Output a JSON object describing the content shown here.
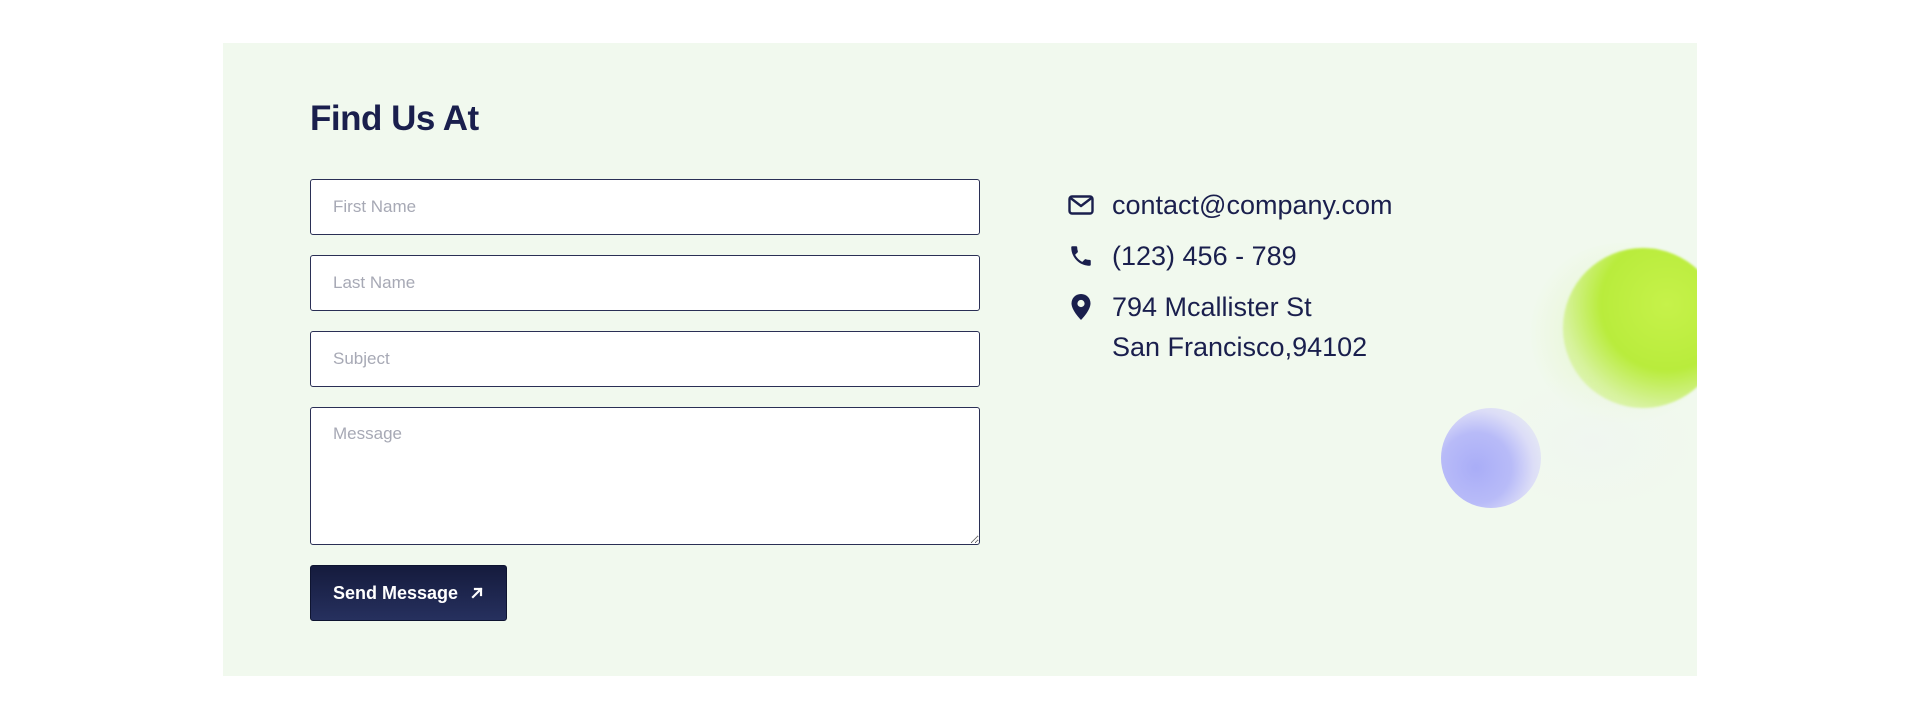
{
  "section": {
    "title": "Find Us At"
  },
  "form": {
    "first_name_placeholder": "First Name",
    "last_name_placeholder": "Last Name",
    "subject_placeholder": "Subject",
    "message_placeholder": "Message",
    "submit_label": "Send Message",
    "submit_icon": "arrow-up-right-icon"
  },
  "contact": {
    "email": "contact@company.com",
    "email_icon": "envelope-icon",
    "phone": "(123) 456 - 789",
    "phone_icon": "phone-icon",
    "address_line1": "794 Mcallister St",
    "address_line2": "San Francisco,94102",
    "address_icon": "map-pin-icon"
  },
  "colors": {
    "panel_background": "#f1f9ee",
    "primary_text": "#1a1f4d",
    "button_background": "#151b3d",
    "orb_green": "#c6f24a",
    "orb_blue": "#a9adf7"
  }
}
